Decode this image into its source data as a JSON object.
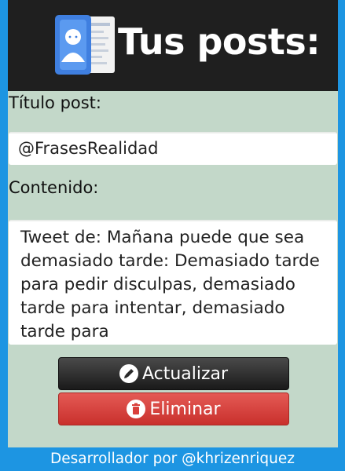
{
  "header": {
    "title": "Tus posts:",
    "icon": "contact-book-icon"
  },
  "form": {
    "title_label": "Título post:",
    "title_value": "@FrasesRealidad",
    "content_label": "Contenido:",
    "content_value": "Tweet de: Mañana puede que sea demasiado tarde: Demasiado tarde para pedir disculpas, demasiado tarde para intentar, demasiado tarde para"
  },
  "buttons": {
    "update_label": "Actualizar",
    "update_icon": "edit-icon",
    "delete_label": "Eliminar",
    "delete_icon": "trash-icon"
  },
  "footer": {
    "text": "Desarrollador por @khrizenriquez"
  },
  "colors": {
    "background": "#1d95e2",
    "panel": "#c3d8c9",
    "header": "#1f1f1f",
    "update_button": "#2a2a2a",
    "delete_button": "#d9403b"
  }
}
